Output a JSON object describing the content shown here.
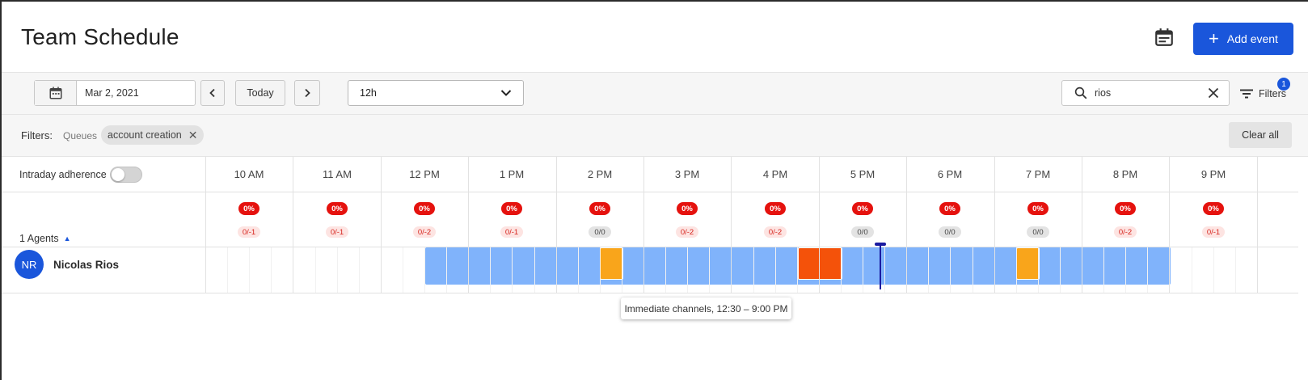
{
  "header": {
    "title": "Team Schedule",
    "calendar_icon": "calendar-icon",
    "add_event_label": "Add event"
  },
  "toolbar": {
    "date": "Mar 2, 2021",
    "today_label": "Today",
    "range_value": "12h",
    "search_value": "rios",
    "filters_label": "Filters",
    "filters_count": "1"
  },
  "filterbar": {
    "label": "Filters:",
    "category": "Queues",
    "chip": "account creation",
    "clear_label": "Clear all"
  },
  "grid": {
    "intraday_label": "Intraday adherence",
    "intraday_enabled": false,
    "agents_label": "1 Agents",
    "hours": [
      {
        "label": "10 AM",
        "pct": "0%",
        "ratio": "0/-1"
      },
      {
        "label": "11 AM",
        "pct": "0%",
        "ratio": "0/-1"
      },
      {
        "label": "12 PM",
        "pct": "0%",
        "ratio": "0/-2"
      },
      {
        "label": "1 PM",
        "pct": "0%",
        "ratio": "0/-1"
      },
      {
        "label": "2 PM",
        "pct": "0%",
        "ratio": "0/0"
      },
      {
        "label": "3 PM",
        "pct": "0%",
        "ratio": "0/-2"
      },
      {
        "label": "4 PM",
        "pct": "0%",
        "ratio": "0/-2"
      },
      {
        "label": "5 PM",
        "pct": "0%",
        "ratio": "0/0"
      },
      {
        "label": "6 PM",
        "pct": "0%",
        "ratio": "0/0"
      },
      {
        "label": "7 PM",
        "pct": "0%",
        "ratio": "0/0"
      },
      {
        "label": "8 PM",
        "pct": "0%",
        "ratio": "0/-2"
      },
      {
        "label": "9 PM",
        "pct": "0%",
        "ratio": "0/-1"
      }
    ],
    "agent": {
      "initials": "NR",
      "name": "Nicolas Rios"
    },
    "tooltip": "Immediate channels, 12:30 – 9:00 PM",
    "colors": {
      "shift": "#80b3fb",
      "break": "#f9a51b",
      "meeting": "#f4520a",
      "accent": "#1a56db",
      "alert": "#e5120e"
    }
  }
}
